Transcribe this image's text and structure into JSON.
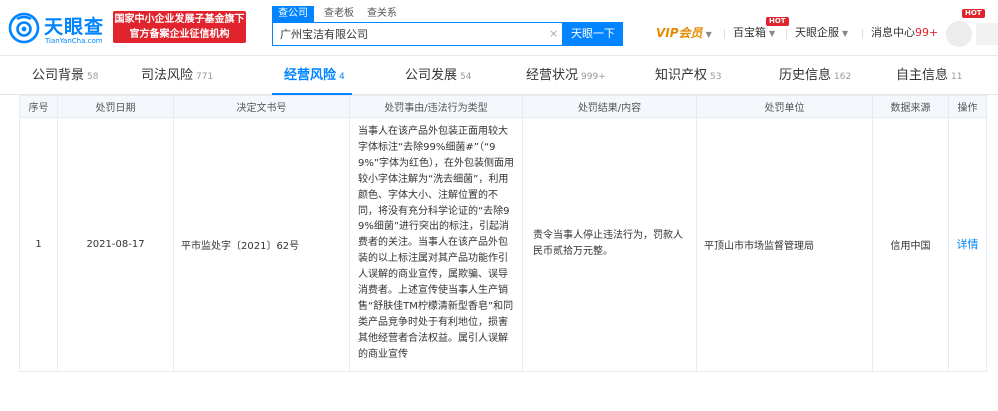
{
  "header": {
    "logo_text": "天眼查",
    "logo_sub": "TianYanCha.com",
    "promo_line1": "国家中小企业发展子基金旗下",
    "promo_line2": "官方备案企业征信机构",
    "search_tabs": [
      "查公司",
      "查老板",
      "查关系"
    ],
    "search_value": "广州宝洁有限公司",
    "search_clear": "×",
    "search_button": "天眼一下",
    "vip_label": "VIP会员",
    "baibaoxiang": "百宝箱",
    "tianyan_qifu": "天眼企服",
    "message_center": "消息中心",
    "message_count": "99+",
    "hot_badge": "HOT"
  },
  "categories": [
    {
      "label": "公司背景",
      "count": "58"
    },
    {
      "label": "司法风险",
      "count": "771"
    },
    {
      "label": "经营风险",
      "count": "4"
    },
    {
      "label": "公司发展",
      "count": "54"
    },
    {
      "label": "经营状况",
      "count": "999+"
    },
    {
      "label": "知识产权",
      "count": "53"
    },
    {
      "label": "历史信息",
      "count": "162"
    },
    {
      "label": "自主信息",
      "count": "11"
    }
  ],
  "active_category": "经营风险",
  "table": {
    "headers": [
      "序号",
      "处罚日期",
      "决定文书号",
      "处罚事由/违法行为类型",
      "处罚结果/内容",
      "处罚单位",
      "数据来源",
      "操作"
    ],
    "rows": [
      {
        "index": "1",
        "date": "2021-08-17",
        "doc_no": "平市监处字〔2021〕62号",
        "reason": "当事人在该产品外包装正面用较大字体标注“去除99%细菌#”（“99%”字体为红色），在外包装侧面用较小字体注解为“洗去细菌”，利用颜色、字体大小、注解位置的不同，将没有充分科学论证的“去除99%细菌”进行突出的标注，引起消费者的关注。当事人在该产品外包装的以上标注属对其产品功能作引人误解的商业宣传，属欺骗、误导消费者。上述宣传使当事人生产销售“舒肤佳TM柠檬清新型香皂”和同类产品竞争时处于有利地位，损害其他经营者合法权益。属引人误解的商业宣传",
        "result": "责令当事人停止违法行为，罚款人民币贰拾万元整。",
        "authority": "平顶山市市场监督管理局",
        "source": "信用中国",
        "action": "详情"
      }
    ]
  },
  "colors": {
    "brand_blue": "#0084ff",
    "promo_red": "#e0232c",
    "vip_orange": "#e58a00"
  }
}
